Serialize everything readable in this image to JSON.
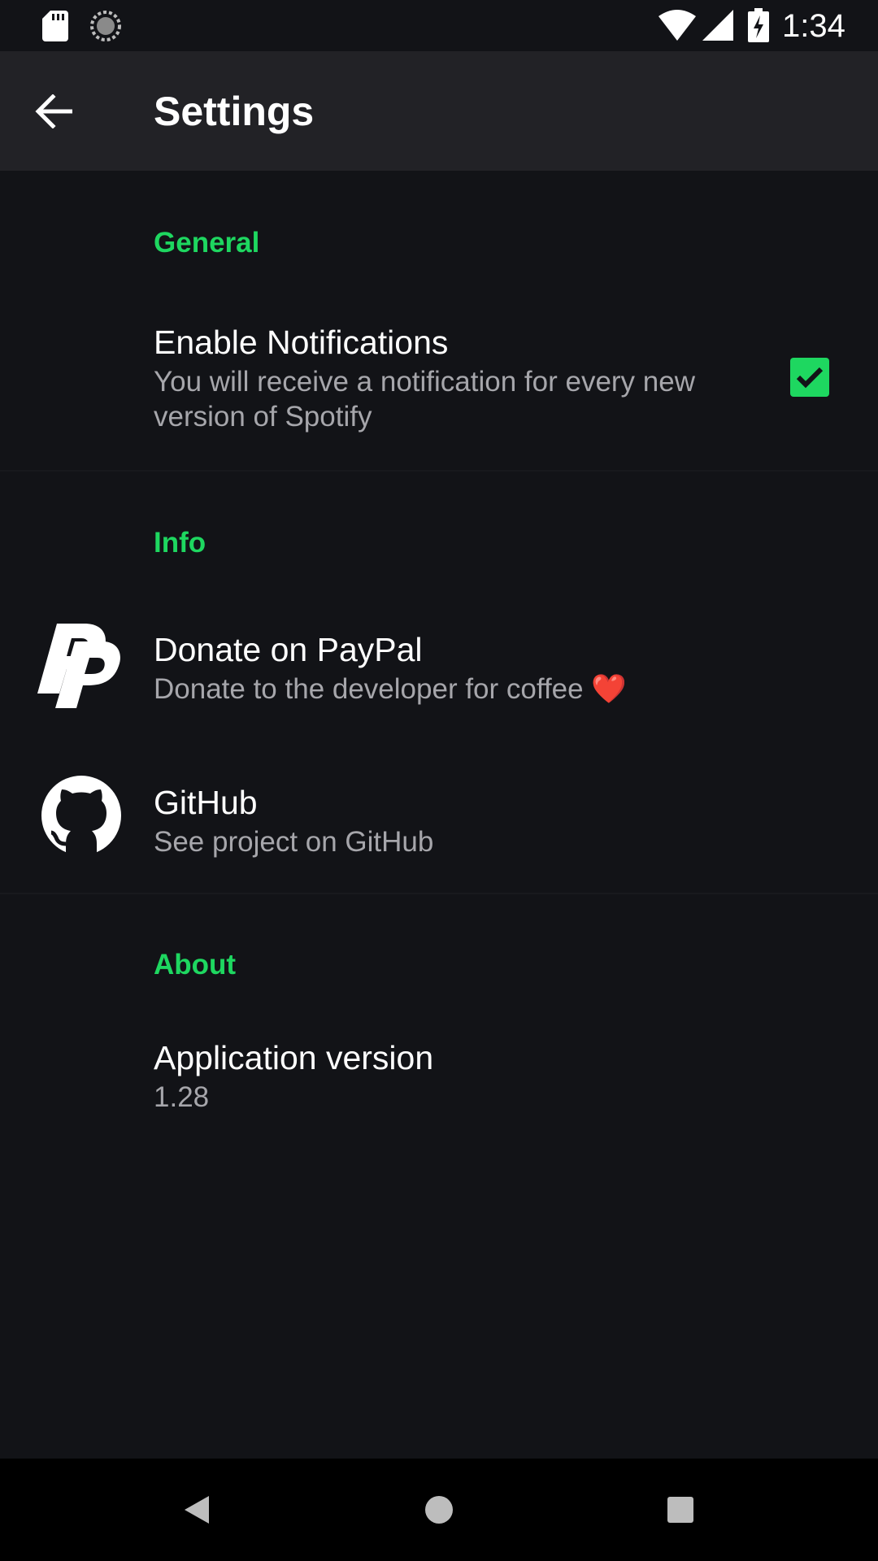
{
  "status_bar": {
    "time": "1:34",
    "icons": [
      "sd-card-icon",
      "sync-icon",
      "wifi-icon",
      "signal-icon",
      "battery-charging-icon"
    ]
  },
  "app_bar": {
    "title": "Settings",
    "back_icon": "arrow-back-icon"
  },
  "sections": {
    "general": {
      "header": "General",
      "notifications": {
        "title": "Enable Notifications",
        "summary": "You will receive a notification for every new version of Spotify",
        "checked": true
      }
    },
    "info": {
      "header": "Info",
      "paypal": {
        "title": "Donate on PayPal",
        "summary": "Donate to the developer for coffee ❤️",
        "icon": "paypal-icon"
      },
      "github": {
        "title": "GitHub",
        "summary": "See project on GitHub",
        "icon": "github-icon"
      }
    },
    "about": {
      "header": "About",
      "version": {
        "title": "Application version",
        "summary": "1.28"
      }
    }
  },
  "nav_bar": {
    "icons": [
      "nav-back-icon",
      "nav-home-icon",
      "nav-recents-icon"
    ]
  },
  "colors": {
    "accent": "#1ed760",
    "background": "#121317",
    "app_bar": "#222226",
    "secondary_text": "#a6a6ab"
  }
}
